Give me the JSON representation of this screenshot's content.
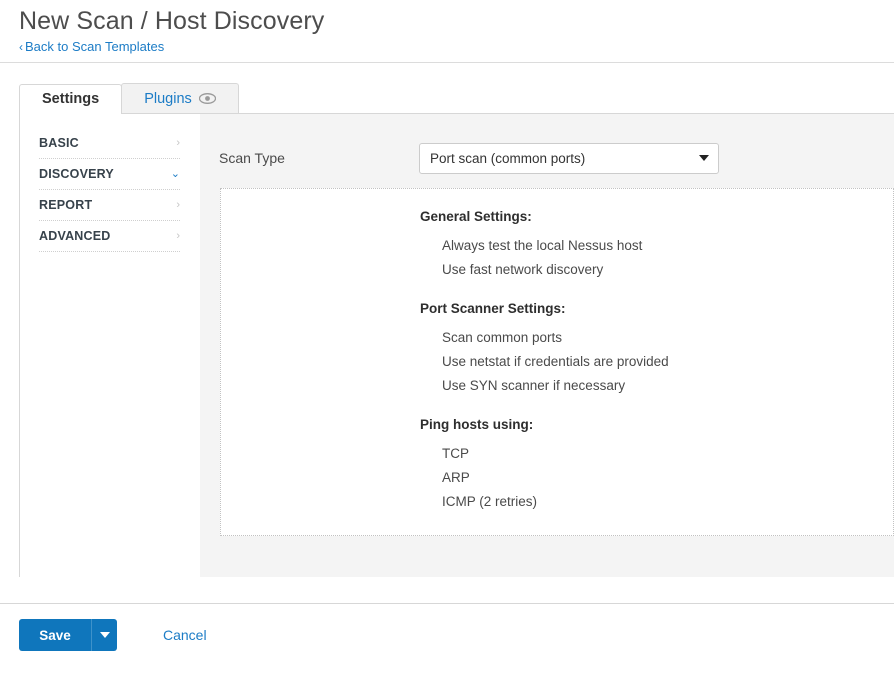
{
  "header": {
    "title": "New Scan / Host Discovery",
    "back_link": "Back to Scan Templates",
    "back_chevron": "‹"
  },
  "tabs": [
    {
      "label": "Settings",
      "active": true,
      "icon": null
    },
    {
      "label": "Plugins",
      "active": false,
      "icon": "eye-icon"
    }
  ],
  "sidebar": {
    "items": [
      {
        "label": "BASIC",
        "state": "collapsed",
        "chevron": "›"
      },
      {
        "label": "DISCOVERY",
        "state": "expanded",
        "chevron": "⌄"
      },
      {
        "label": "REPORT",
        "state": "collapsed",
        "chevron": "›"
      },
      {
        "label": "ADVANCED",
        "state": "collapsed",
        "chevron": "›"
      }
    ]
  },
  "settings": {
    "scan_type_label": "Scan Type",
    "scan_type_value": "Port scan (common ports)",
    "groups": [
      {
        "title": "General Settings:",
        "items": [
          "Always test the local Nessus host",
          "Use fast network discovery"
        ]
      },
      {
        "title": "Port Scanner Settings:",
        "items": [
          "Scan common ports",
          "Use netstat if credentials are provided",
          "Use SYN scanner if necessary"
        ]
      },
      {
        "title": "Ping hosts using:",
        "items": [
          "TCP",
          "ARP",
          "ICMP (2 retries)"
        ]
      }
    ]
  },
  "footer": {
    "save_label": "Save",
    "cancel_label": "Cancel"
  },
  "colors": {
    "accent_blue": "#1c7cc6",
    "button_blue": "#0f76bc",
    "panel_grey": "#f4f4f4",
    "tab_inactive_grey": "#f2f2f2",
    "title_grey": "#4d4d4d",
    "border_grey": "#d7d7d7"
  }
}
